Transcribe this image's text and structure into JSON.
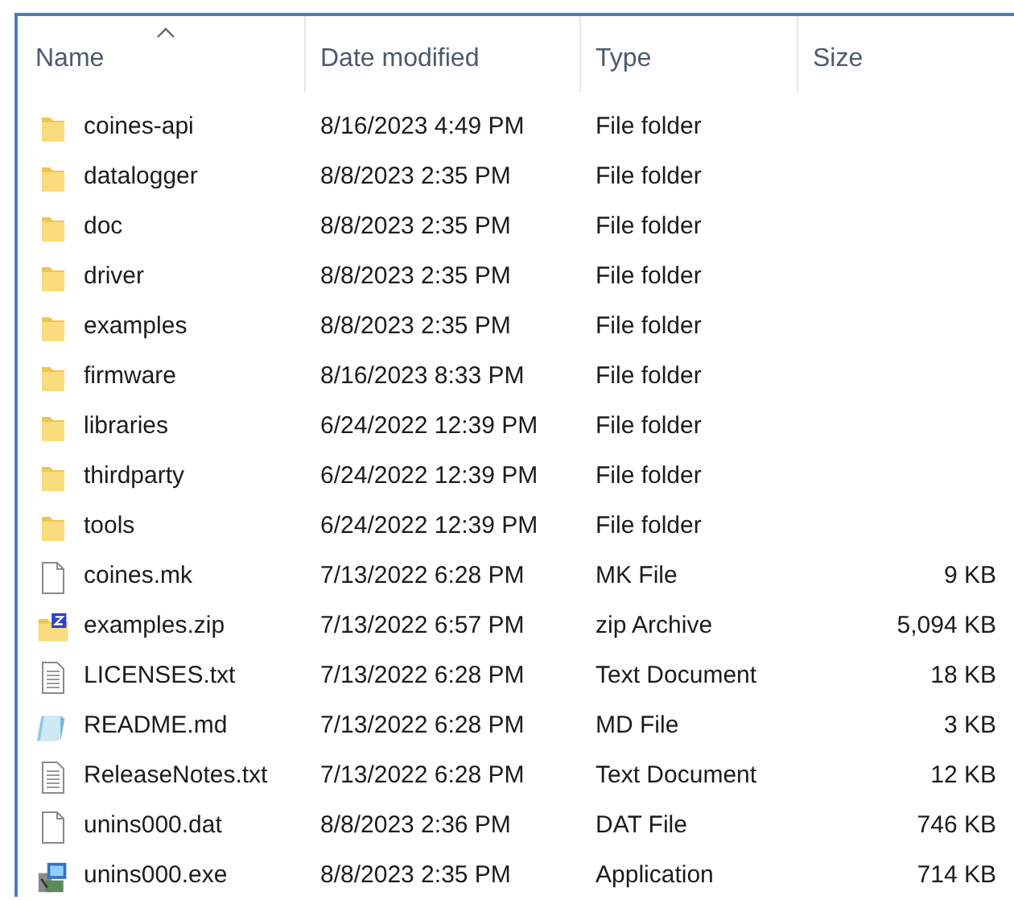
{
  "columns": [
    {
      "label": "Name",
      "sorted": true
    },
    {
      "label": "Date modified",
      "sorted": false
    },
    {
      "label": "Type",
      "sorted": false
    },
    {
      "label": "Size",
      "sorted": false
    }
  ],
  "rows": [
    {
      "kind": "folder",
      "name": "coines-api",
      "date": "8/16/2023 4:49 PM",
      "type": "File folder"
    },
    {
      "kind": "folder",
      "name": "datalogger",
      "date": "8/8/2023 2:35 PM",
      "type": "File folder"
    },
    {
      "kind": "folder",
      "name": "doc",
      "date": "8/8/2023 2:35 PM",
      "type": "File folder"
    },
    {
      "kind": "folder",
      "name": "driver",
      "date": "8/8/2023 2:35 PM",
      "type": "File folder"
    },
    {
      "kind": "folder",
      "name": "examples",
      "date": "8/8/2023 2:35 PM",
      "type": "File folder"
    },
    {
      "kind": "folder",
      "name": "firmware",
      "date": "8/16/2023 8:33 PM",
      "type": "File folder"
    },
    {
      "kind": "folder",
      "name": "libraries",
      "date": "6/24/2022 12:39 PM",
      "type": "File folder"
    },
    {
      "kind": "folder",
      "name": "thirdparty",
      "date": "6/24/2022 12:39 PM",
      "type": "File folder"
    },
    {
      "kind": "folder",
      "name": "tools",
      "date": "6/24/2022 12:39 PM",
      "type": "File folder"
    },
    {
      "kind": "file",
      "name": "coines.mk",
      "date": "7/13/2022 6:28 PM",
      "type": "MK File",
      "size": "9 KB"
    },
    {
      "kind": "zip",
      "name": "examples.zip",
      "date": "7/13/2022 6:57 PM",
      "type": "zip Archive",
      "size": "5,094 KB"
    },
    {
      "kind": "text",
      "name": "LICENSES.txt",
      "date": "7/13/2022 6:28 PM",
      "type": "Text Document",
      "size": "18 KB"
    },
    {
      "kind": "notepad",
      "name": "README.md",
      "date": "7/13/2022 6:28 PM",
      "type": "MD File",
      "size": "3 KB"
    },
    {
      "kind": "text",
      "name": "ReleaseNotes.txt",
      "date": "7/13/2022 6:28 PM",
      "type": "Text Document",
      "size": "12 KB"
    },
    {
      "kind": "file",
      "name": "unins000.dat",
      "date": "8/8/2023 2:36 PM",
      "type": "DAT File",
      "size": "746 KB"
    },
    {
      "kind": "app",
      "name": "unins000.exe",
      "date": "8/8/2023 2:35 PM",
      "type": "Application",
      "size": "714 KB"
    }
  ]
}
